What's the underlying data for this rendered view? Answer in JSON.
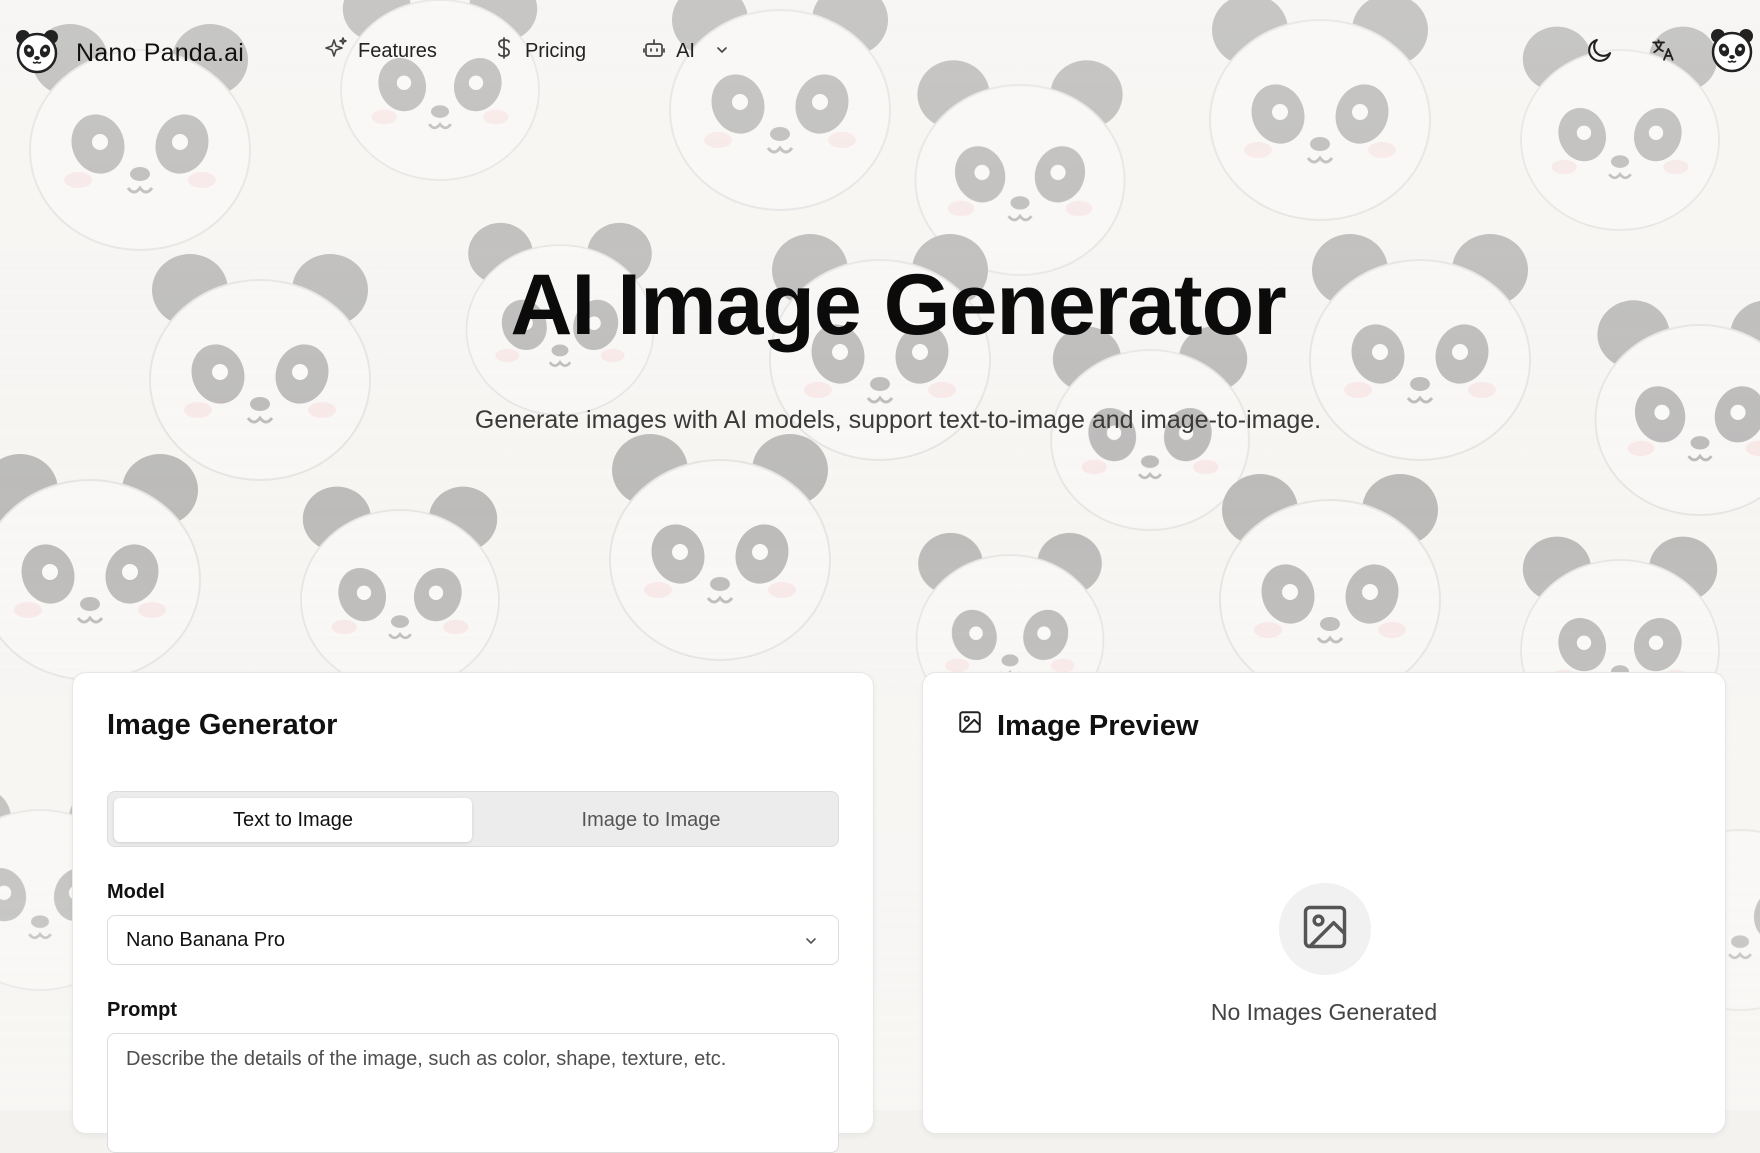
{
  "brand": {
    "name": "Nano Panda.ai",
    "logo_icon": "panda-logo-icon"
  },
  "nav": {
    "links": [
      {
        "label": "Features",
        "icon": "sparkles-icon"
      },
      {
        "label": "Pricing",
        "icon": "dollar-icon"
      },
      {
        "label": "AI",
        "icon": "robot-icon",
        "has_dropdown": true
      }
    ],
    "right_icons": [
      "moon-icon",
      "translate-icon",
      "avatar-panda-icon"
    ]
  },
  "hero": {
    "title": "AI Image Generator",
    "subtitle": "Generate images with AI models, support text-to-image and image-to-image."
  },
  "generator": {
    "title": "Image Generator",
    "tabs": [
      {
        "label": "Text to Image",
        "active": true
      },
      {
        "label": "Image to Image",
        "active": false
      }
    ],
    "model_label": "Model",
    "model_value": "Nano Banana Pro",
    "prompt_label": "Prompt",
    "prompt_placeholder": "Describe the details of the image, such as color, shape, texture, etc."
  },
  "preview": {
    "title": "Image Preview",
    "empty_text": "No Images Generated"
  },
  "colors": {
    "text": "#111111",
    "muted": "#555555",
    "border": "#dcdcdc",
    "background": "#f4f2ef"
  }
}
